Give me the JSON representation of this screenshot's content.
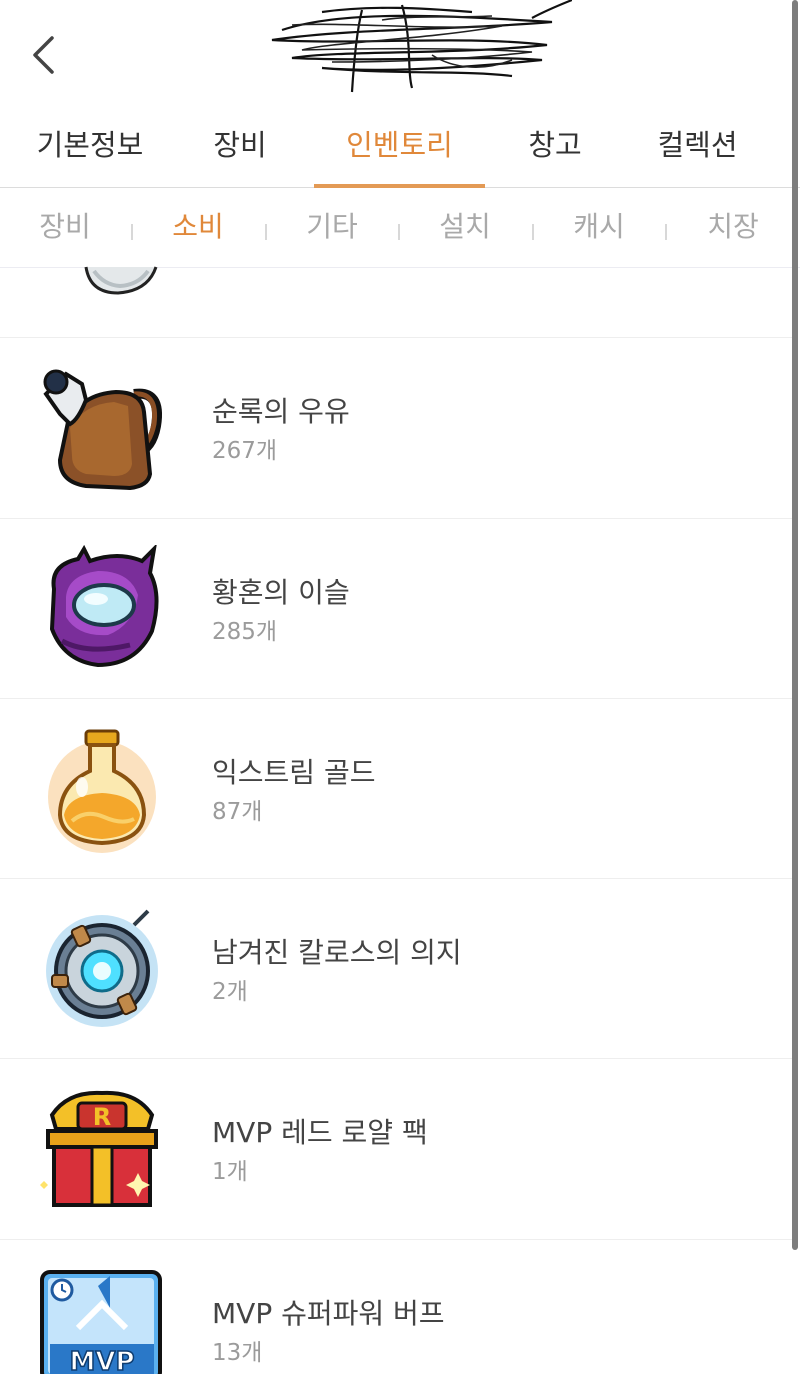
{
  "nav": {
    "back_icon": "chevron-left-icon",
    "tabs": [
      {
        "label": "기본정보",
        "active": false
      },
      {
        "label": "장비",
        "active": false
      },
      {
        "label": "인벤토리",
        "active": true
      },
      {
        "label": "창고",
        "active": false
      },
      {
        "label": "컬렉션",
        "active": false
      }
    ]
  },
  "subtabs": [
    {
      "label": "장비",
      "active": false
    },
    {
      "label": "소비",
      "active": true
    },
    {
      "label": "기타",
      "active": false
    },
    {
      "label": "설치",
      "active": false
    },
    {
      "label": "캐시",
      "active": false
    },
    {
      "label": "치장",
      "active": false
    }
  ],
  "items": [
    {
      "name": "",
      "count": "",
      "icon": "silver-coin-icon"
    },
    {
      "name": "순록의 우유",
      "count": "267개",
      "icon": "milk-jug-icon"
    },
    {
      "name": "황혼의 이슬",
      "count": "285개",
      "icon": "purple-dew-icon"
    },
    {
      "name": "익스트림 골드",
      "count": "87개",
      "icon": "gold-potion-icon"
    },
    {
      "name": "남겨진 칼로스의 의지",
      "count": "2개",
      "icon": "kalos-will-icon"
    },
    {
      "name": "MVP 레드 로얄 팩",
      "count": "1개",
      "icon": "red-gift-box-icon"
    },
    {
      "name": "MVP 슈퍼파워 버프",
      "count": "13개",
      "icon": "mvp-card-icon"
    }
  ],
  "colors": {
    "accent": "#e0883a",
    "underline": "#e39a55",
    "inactive_subtab": "#a9a9a9",
    "count_text": "#9b9b9b"
  }
}
